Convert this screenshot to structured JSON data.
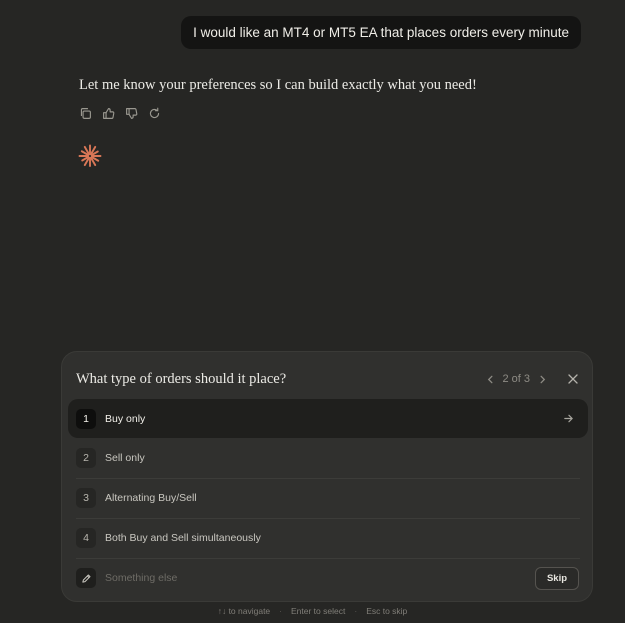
{
  "conversation": {
    "user_message": "I would like an MT4 or MT5 EA that places orders every minute",
    "assistant_message": "Let me know your preferences so I can build exactly what you need!",
    "actions": [
      "copy-icon",
      "thumbs-up-icon",
      "thumbs-down-icon",
      "retry-icon"
    ]
  },
  "question": {
    "title": "What type of orders should it place?",
    "pager": "2 of 3",
    "options": [
      {
        "num": "1",
        "label": "Buy only"
      },
      {
        "num": "2",
        "label": "Sell only"
      },
      {
        "num": "3",
        "label": "Alternating Buy/Sell"
      },
      {
        "num": "4",
        "label": "Both Buy and Sell simultaneously"
      }
    ],
    "other_placeholder": "Something else",
    "skip_label": "Skip"
  },
  "hints": {
    "navigate": "↑↓ to navigate",
    "select": "Enter to select",
    "skip": "Esc to skip",
    "separator": "·"
  },
  "colors": {
    "background": "#262624",
    "panel": "#30302e",
    "accent": "#d97757"
  }
}
